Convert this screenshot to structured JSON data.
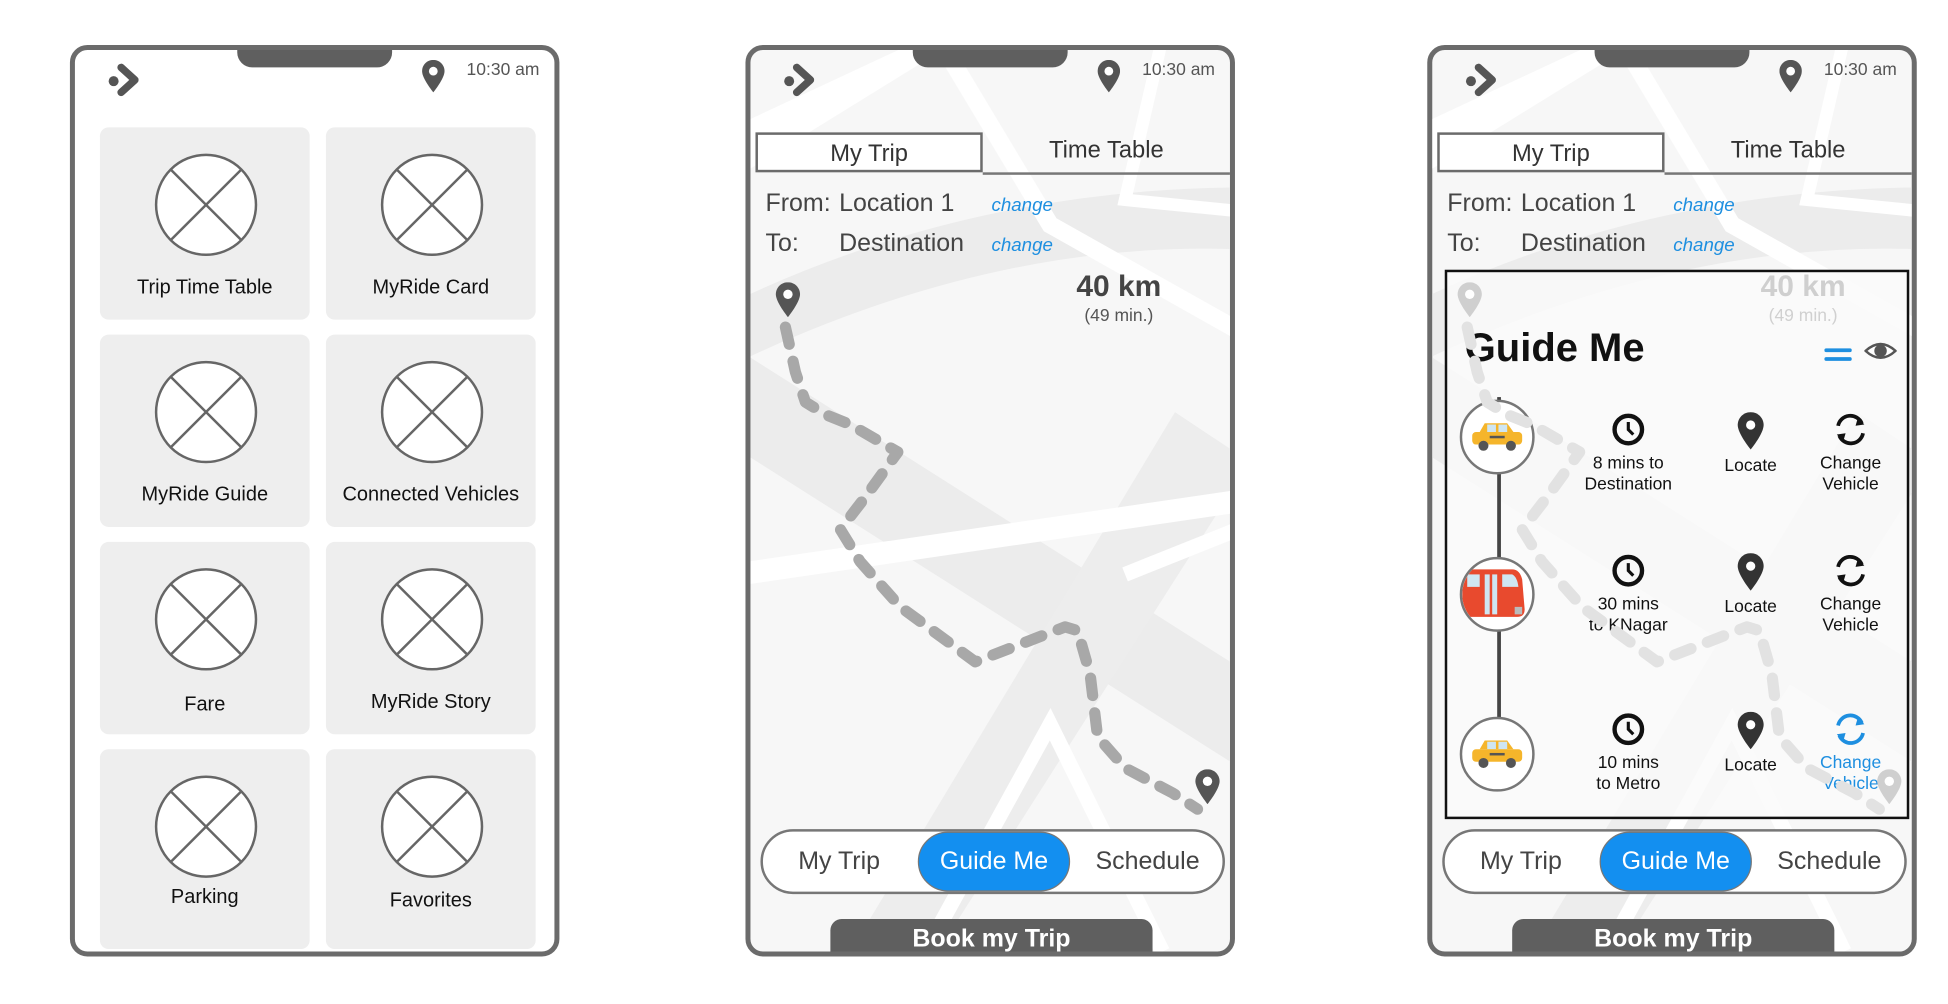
{
  "status_bar": {
    "time": "10:30 am"
  },
  "home": {
    "tiles": [
      {
        "label": "Trip Time Table"
      },
      {
        "label": "MyRide Card"
      },
      {
        "label": "MyRide Guide"
      },
      {
        "label": "Connected Vehicles"
      },
      {
        "label": "Fare"
      },
      {
        "label": "MyRide Story"
      },
      {
        "label": "Parking"
      },
      {
        "label": "Favorites"
      }
    ]
  },
  "trip": {
    "tabs": [
      {
        "label": "My Trip",
        "active": true
      },
      {
        "label": "Time Table",
        "active": false
      }
    ],
    "from_label": "From:",
    "from_value": "Location 1",
    "to_label": "To:",
    "to_value": "Destination",
    "change_label": "change",
    "distance": "40 km",
    "duration": "(49 min.)",
    "segments": [
      {
        "label": "My Trip"
      },
      {
        "label": "Guide Me",
        "selected": true
      },
      {
        "label": "Schedule"
      }
    ],
    "book_label": "Book my Trip"
  },
  "guide": {
    "title": "Guide Me",
    "legs": [
      {
        "vehicle": "taxi",
        "time_text_1": "8 mins to",
        "time_text_2": "Destination",
        "locate": "Locate",
        "change_1": "Change",
        "change_2": "Vehicle",
        "highlight": false
      },
      {
        "vehicle": "bus",
        "time_text_1": "30 mins",
        "time_text_2": "to KNagar",
        "locate": "Locate",
        "change_1": "Change",
        "change_2": "Vehicle",
        "highlight": false
      },
      {
        "vehicle": "taxi",
        "time_text_1": "10 mins",
        "time_text_2": "to Metro",
        "locate": "Locate",
        "change_1": "Change",
        "change_2": "Vehicle",
        "highlight": true
      }
    ]
  },
  "colors": {
    "accent": "#138ff0",
    "link": "#1e8fe0",
    "frame": "#6b6b6b",
    "tile": "#eeeeee",
    "button_dark": "#5f5f5f"
  }
}
